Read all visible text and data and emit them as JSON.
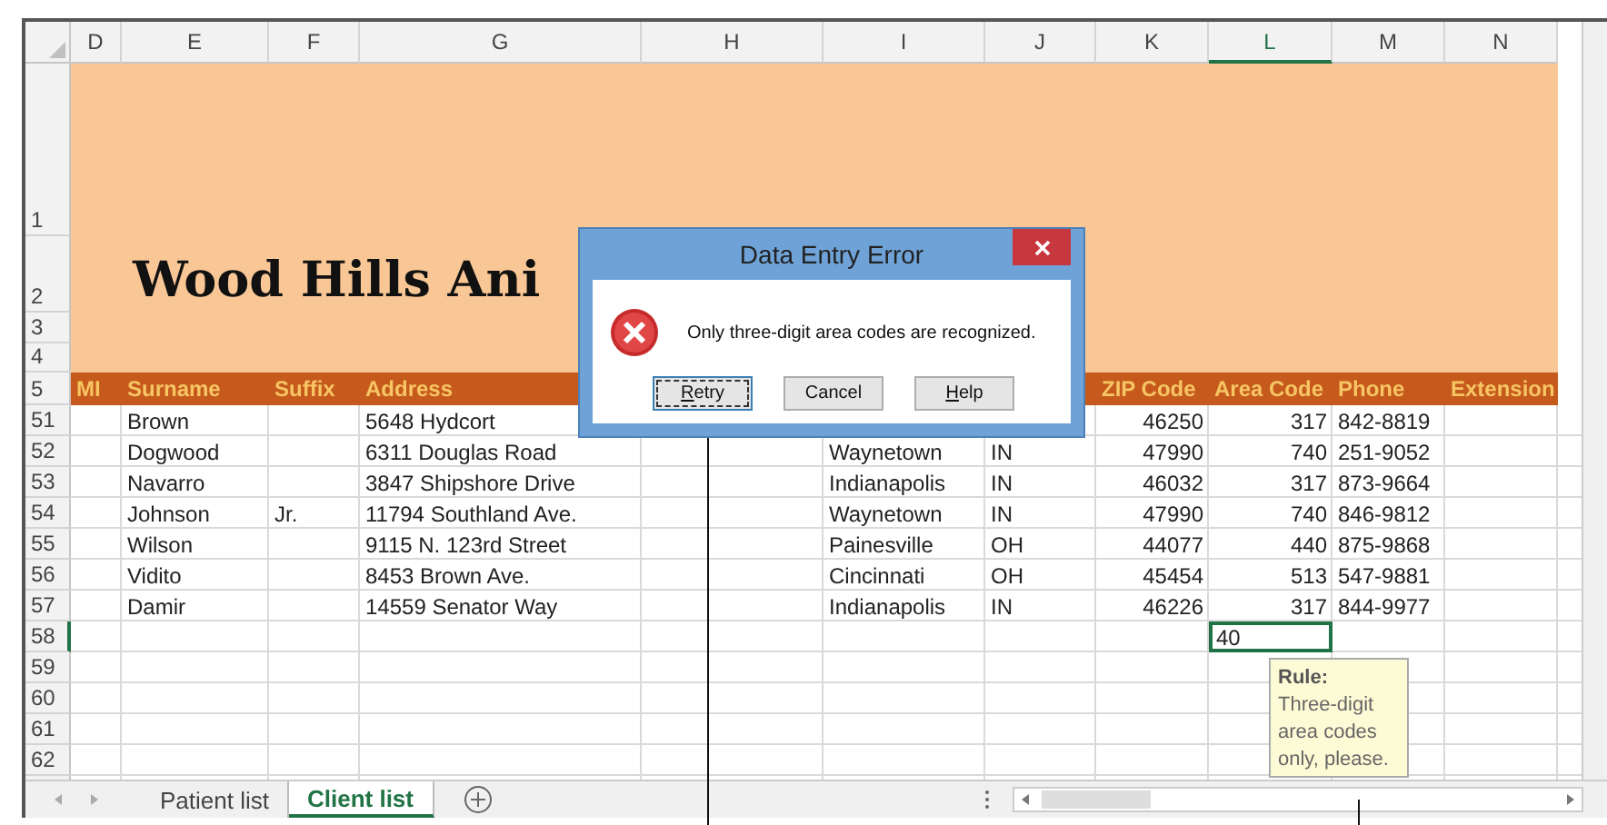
{
  "columns": [
    {
      "letter": "D",
      "selected": false
    },
    {
      "letter": "E",
      "selected": false
    },
    {
      "letter": "F",
      "selected": false
    },
    {
      "letter": "G",
      "selected": false
    },
    {
      "letter": "H",
      "selected": false
    },
    {
      "letter": "I",
      "selected": false
    },
    {
      "letter": "J",
      "selected": false
    },
    {
      "letter": "K",
      "selected": false,
      "numeric": true
    },
    {
      "letter": "L",
      "selected": true,
      "numeric": true
    },
    {
      "letter": "M",
      "selected": false
    },
    {
      "letter": "N",
      "selected": false
    }
  ],
  "banner": {
    "row_numbers": [
      "1",
      "2",
      "3",
      "4"
    ],
    "title": "Wood Hills Ani"
  },
  "header_row": {
    "number": "5",
    "cells": {
      "D": "MI",
      "E": "Surname",
      "F": "Suffix",
      "G": "Address",
      "K": "ZIP Code",
      "L": "Area Code",
      "M": "Phone",
      "N": "Extension"
    }
  },
  "rows": [
    {
      "number": "51",
      "active": false,
      "cells": {
        "E": "Brown",
        "G": "5648 Hydcort",
        "K": "46250",
        "L": "317",
        "M": "842-8819"
      }
    },
    {
      "number": "52",
      "active": false,
      "cells": {
        "E": "Dogwood",
        "G": "6311 Douglas Road",
        "I": "Waynetown",
        "J": "IN",
        "K": "47990",
        "L": "740",
        "M": "251-9052"
      }
    },
    {
      "number": "53",
      "active": false,
      "cells": {
        "E": "Navarro",
        "G": "3847 Shipshore Drive",
        "I": "Indianapolis",
        "J": "IN",
        "K": "46032",
        "L": "317",
        "M": "873-9664"
      }
    },
    {
      "number": "54",
      "active": false,
      "cells": {
        "E": "Johnson",
        "F": "Jr.",
        "G": "11794 Southland Ave.",
        "I": "Waynetown",
        "J": "IN",
        "K": "47990",
        "L": "740",
        "M": "846-9812"
      }
    },
    {
      "number": "55",
      "active": false,
      "cells": {
        "E": "Wilson",
        "G": "9115 N. 123rd Street",
        "I": "Painesville",
        "J": "OH",
        "K": "44077",
        "L": "440",
        "M": "875-9868"
      }
    },
    {
      "number": "56",
      "active": false,
      "cells": {
        "E": "Vidito",
        "G": "8453 Brown Ave.",
        "I": "Cincinnati",
        "J": "OH",
        "K": "45454",
        "L": "513",
        "M": "547-9881"
      }
    },
    {
      "number": "57",
      "active": false,
      "cells": {
        "E": "Damir",
        "G": "14559 Senator Way",
        "I": "Indianapolis",
        "J": "IN",
        "K": "46226",
        "L": "317",
        "M": "844-9977"
      }
    },
    {
      "number": "58",
      "active": true,
      "cells": {
        "L": {
          "text": "40",
          "selected": true
        }
      }
    },
    {
      "number": "59",
      "active": false,
      "cells": {}
    },
    {
      "number": "60",
      "active": false,
      "cells": {}
    },
    {
      "number": "61",
      "active": false,
      "cells": {}
    },
    {
      "number": "62",
      "active": false,
      "cells": {}
    }
  ],
  "input_message": {
    "title": "Rule:",
    "text": "Three-digit area codes only, please."
  },
  "dialog": {
    "title": "Data Entry Error",
    "message": "Only three-digit area codes are recognized.",
    "buttons": [
      {
        "label": "Retry",
        "access_key_underlined": true,
        "focused": true
      },
      {
        "label": "Cancel",
        "access_key_underlined": false,
        "focused": false
      },
      {
        "label": "Help",
        "access_key_underlined": true,
        "focused": false
      }
    ]
  },
  "sheet_tabs": [
    {
      "label": "Patient list",
      "selected": false
    },
    {
      "label": "Client list",
      "selected": true
    }
  ]
}
